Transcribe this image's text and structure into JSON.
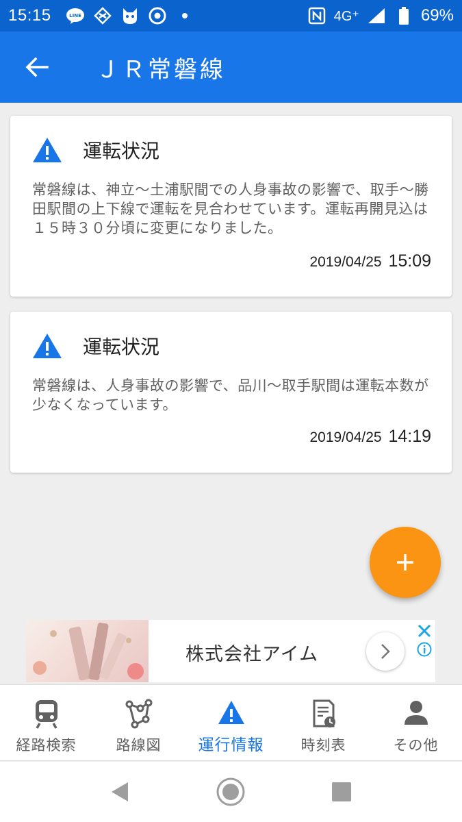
{
  "status_bar": {
    "time": "15:15",
    "network": "4G⁺",
    "battery": "69%",
    "icons": [
      "line-icon",
      "sync-icon",
      "cat-app-icon",
      "chrome-icon",
      "dot-icon",
      "nfc-icon",
      "signal-icon",
      "battery-icon"
    ]
  },
  "app_bar": {
    "title": "ＪＲ常磐線"
  },
  "cards": [
    {
      "title": "運転状況",
      "body": "常磐線は、神立〜土浦駅間での人身事故の影響で、取手〜勝田駅間の上下線で運転を見合わせています。運転再開見込は１５時３０分頃に変更になりました。",
      "date": "2019/04/25",
      "time": "15:09"
    },
    {
      "title": "運転状況",
      "body": "常磐線は、人身事故の影響で、品川〜取手駅間は運転本数が少なくなっています。",
      "date": "2019/04/25",
      "time": "14:19"
    }
  ],
  "ad": {
    "text": "株式会社アイム"
  },
  "bottom_nav": [
    {
      "label": "経路検索",
      "icon": "train-icon"
    },
    {
      "label": "路線図",
      "icon": "route-map-icon"
    },
    {
      "label": "運行情報",
      "icon": "warning-icon",
      "active": true
    },
    {
      "label": "時刻表",
      "icon": "timetable-icon"
    },
    {
      "label": "その他",
      "icon": "person-icon"
    }
  ],
  "colors": {
    "primary": "#1976e8",
    "status_bar": "#0b63ce",
    "accent": "#fb9412",
    "background": "#eeeeee"
  }
}
